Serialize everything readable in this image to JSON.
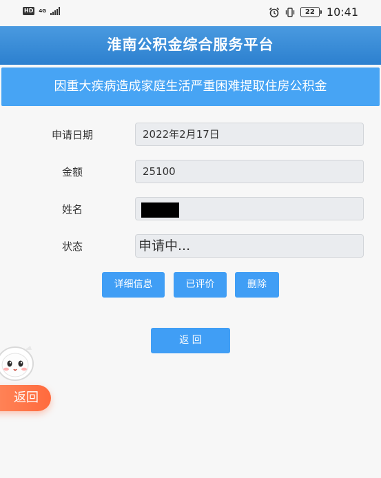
{
  "status_bar": {
    "hd": "HD",
    "network": "4G",
    "battery": "22",
    "time": "10:41"
  },
  "header": {
    "title": "淮南公积金综合服务平台"
  },
  "subtitle": "因重大疾病造成家庭生活严重困难提取住房公积金",
  "form": {
    "date_label": "申请日期",
    "date_value": "2022年2月17日",
    "amount_label": "金额",
    "amount_value": "25100",
    "name_label": "姓名",
    "name_value": "",
    "status_label": "状态",
    "status_value": "申请中..."
  },
  "actions": {
    "details": "详细信息",
    "rated": "已评价",
    "delete": "删除"
  },
  "back_button": "返 回",
  "floating": {
    "back": "返回"
  },
  "colors": {
    "header": "#2c80cf",
    "subtitle": "#47a4f4",
    "button": "#409ef5",
    "float": "#ff6a3d"
  }
}
